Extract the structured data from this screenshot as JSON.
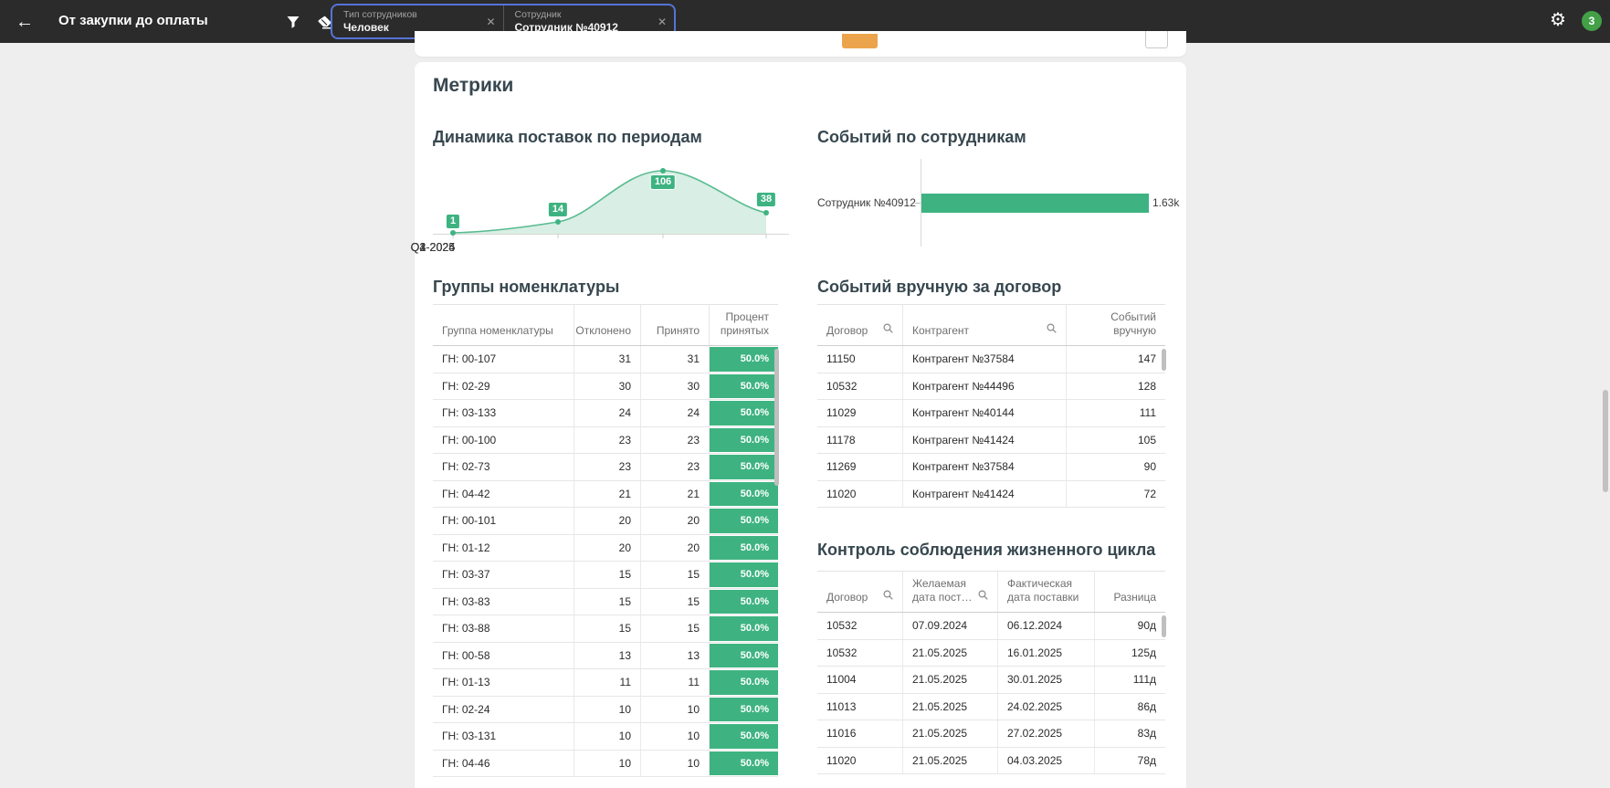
{
  "topbar": {
    "title": "От закупки до оплаты",
    "back_glyph": "←",
    "filters": [
      {
        "label": "Тип сотрудников",
        "value": "Человек",
        "close": "✕"
      },
      {
        "label": "Сотрудник",
        "value": "Сотрудник №40912",
        "close": "✕"
      }
    ],
    "gear_glyph": "⚙",
    "notifications_count": "3",
    "colors": {
      "bar_bg": "#2b2b2b",
      "chip_border": "#5673d7",
      "badge_green": "#43a047"
    }
  },
  "metrics": {
    "title": "Метрики"
  },
  "area_chart": {
    "title": "Динамика поставок по периодам",
    "chart_data": {
      "type": "area",
      "categories": [
        "Q3-2024",
        "Q4-2024",
        "Q1-2025",
        "Q2-2025"
      ],
      "values": [
        "1",
        "14",
        "106",
        "38"
      ],
      "color": "#3eb381",
      "ylim": [
        0,
        110
      ],
      "grid": false,
      "legend": "none"
    }
  },
  "bar_chart": {
    "title": "Событий по сотрудникам",
    "chart_data": {
      "type": "bar",
      "orientation": "horizontal",
      "categories": [
        "Сотрудник №40912"
      ],
      "values": [
        1630
      ],
      "value_labels": [
        "1.63k"
      ],
      "color": "#3eb381"
    }
  },
  "nomenclature_table": {
    "title": "Группы номенклатуры",
    "columns": {
      "c0": "Группа номенклатуры",
      "c1": "Отклонено",
      "c2": "Принято",
      "c3a": "Процент",
      "c3b": "принятых"
    },
    "rows": [
      [
        "ГН: 00-107",
        "31",
        "31",
        "50.0%"
      ],
      [
        "ГН: 02-29",
        "30",
        "30",
        "50.0%"
      ],
      [
        "ГН: 03-133",
        "24",
        "24",
        "50.0%"
      ],
      [
        "ГН: 00-100",
        "23",
        "23",
        "50.0%"
      ],
      [
        "ГН: 02-73",
        "23",
        "23",
        "50.0%"
      ],
      [
        "ГН: 04-42",
        "21",
        "21",
        "50.0%"
      ],
      [
        "ГН: 00-101",
        "20",
        "20",
        "50.0%"
      ],
      [
        "ГН: 01-12",
        "20",
        "20",
        "50.0%"
      ],
      [
        "ГН: 03-37",
        "15",
        "15",
        "50.0%"
      ],
      [
        "ГН: 03-83",
        "15",
        "15",
        "50.0%"
      ],
      [
        "ГН: 03-88",
        "15",
        "15",
        "50.0%"
      ],
      [
        "ГН: 00-58",
        "13",
        "13",
        "50.0%"
      ],
      [
        "ГН: 01-13",
        "11",
        "11",
        "50.0%"
      ],
      [
        "ГН: 02-24",
        "10",
        "10",
        "50.0%"
      ],
      [
        "ГН: 03-131",
        "10",
        "10",
        "50.0%"
      ],
      [
        "ГН: 04-46",
        "10",
        "10",
        "50.0%"
      ]
    ]
  },
  "manual_events_table": {
    "title": "Событий вручную за договор",
    "columns": {
      "c0": "Договор",
      "c1": "Контрагент",
      "c2a": "Событий",
      "c2b": "вручную"
    },
    "rows": [
      [
        "11150",
        "Контрагент №37584",
        "147"
      ],
      [
        "10532",
        "Контрагент №44496",
        "128"
      ],
      [
        "11029",
        "Контрагент №40144",
        "111"
      ],
      [
        "11178",
        "Контрагент №41424",
        "105"
      ],
      [
        "11269",
        "Контрагент №37584",
        "90"
      ],
      [
        "11020",
        "Контрагент №41424",
        "72"
      ]
    ]
  },
  "lifecycle_table": {
    "title": "Контроль соблюдения жизненного цикла",
    "columns": {
      "c0": "Договор",
      "c1a": "Желаемая",
      "c1b": "дата пост…",
      "c2a": "Фактическая",
      "c2b": "дата поставки",
      "c3": "Разница"
    },
    "rows": [
      [
        "10532",
        "07.09.2024",
        "06.12.2024",
        "90д"
      ],
      [
        "10532",
        "21.05.2025",
        "16.01.2025",
        "125д"
      ],
      [
        "11004",
        "21.05.2025",
        "30.01.2025",
        "111д"
      ],
      [
        "11013",
        "21.05.2025",
        "24.02.2025",
        "86д"
      ],
      [
        "11016",
        "21.05.2025",
        "27.02.2025",
        "83д"
      ],
      [
        "11020",
        "21.05.2025",
        "04.03.2025",
        "78д"
      ]
    ]
  }
}
